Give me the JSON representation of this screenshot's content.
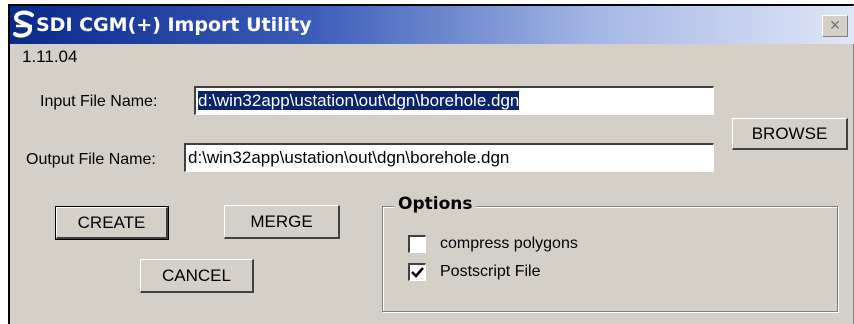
{
  "window": {
    "title": "SDI CGM(+) Import Utility",
    "close_glyph": "×",
    "version": "1.11.04"
  },
  "input": {
    "label": "Input File Name:",
    "value": "d:\\win32app\\ustation\\out\\dgn\\borehole.dgn"
  },
  "output": {
    "label": "Output File Name:",
    "value": "d:\\win32app\\ustation\\out\\dgn\\borehole.dgn"
  },
  "buttons": {
    "browse": "BROWSE",
    "create": "CREATE",
    "merge": "MERGE",
    "cancel": "CANCEL"
  },
  "options": {
    "title": "Options",
    "items": [
      {
        "label": "compress polygons",
        "checked": false
      },
      {
        "label": "Postscript File",
        "checked": true
      }
    ]
  },
  "colors": {
    "title_bar_start": "#0a2a8a",
    "title_bar_end": "#dfe6f6",
    "selection": "#0a246a",
    "face": "#d4d0c8"
  },
  "icons": {
    "app": "sdi-logo-icon",
    "close": "close-icon",
    "check": "checkmark-icon"
  }
}
